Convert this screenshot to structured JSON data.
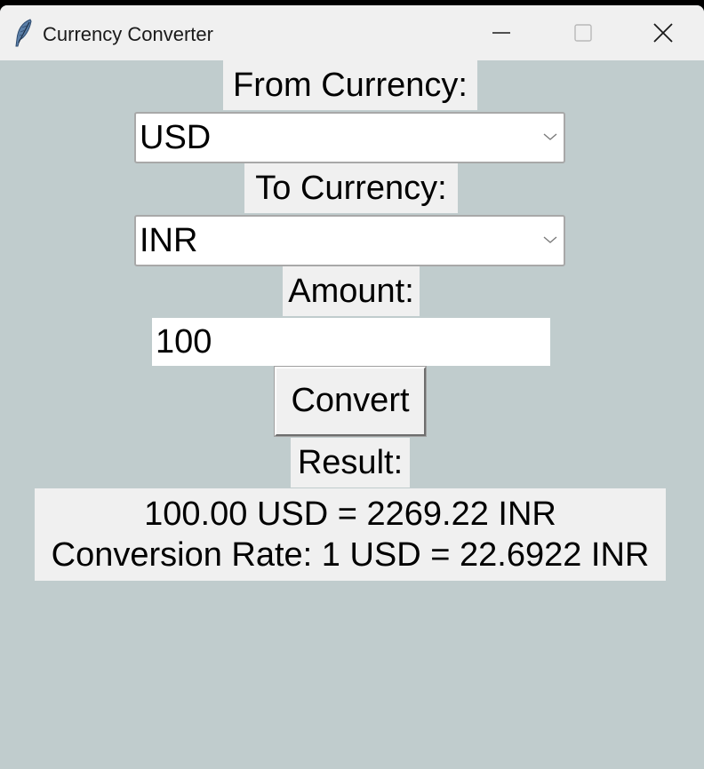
{
  "window": {
    "title": "Currency Converter"
  },
  "form": {
    "from_label": "From Currency:",
    "from_value": "USD",
    "to_label": "To Currency:",
    "to_value": "INR",
    "amount_label": "Amount:",
    "amount_value": "100",
    "convert_label": "Convert",
    "result_label": "Result:"
  },
  "result": {
    "line1": "100.00 USD = 2269.22 INR",
    "line2": "Conversion Rate: 1 USD = 22.6922 INR"
  },
  "icons": {
    "app": "feather-icon",
    "minimize": "minimize-icon",
    "maximize": "maximize-icon",
    "close": "close-icon",
    "dropdown": "chevron-down-icon"
  },
  "colors": {
    "background": "#c0cccd",
    "widget": "#f0f0f0"
  }
}
